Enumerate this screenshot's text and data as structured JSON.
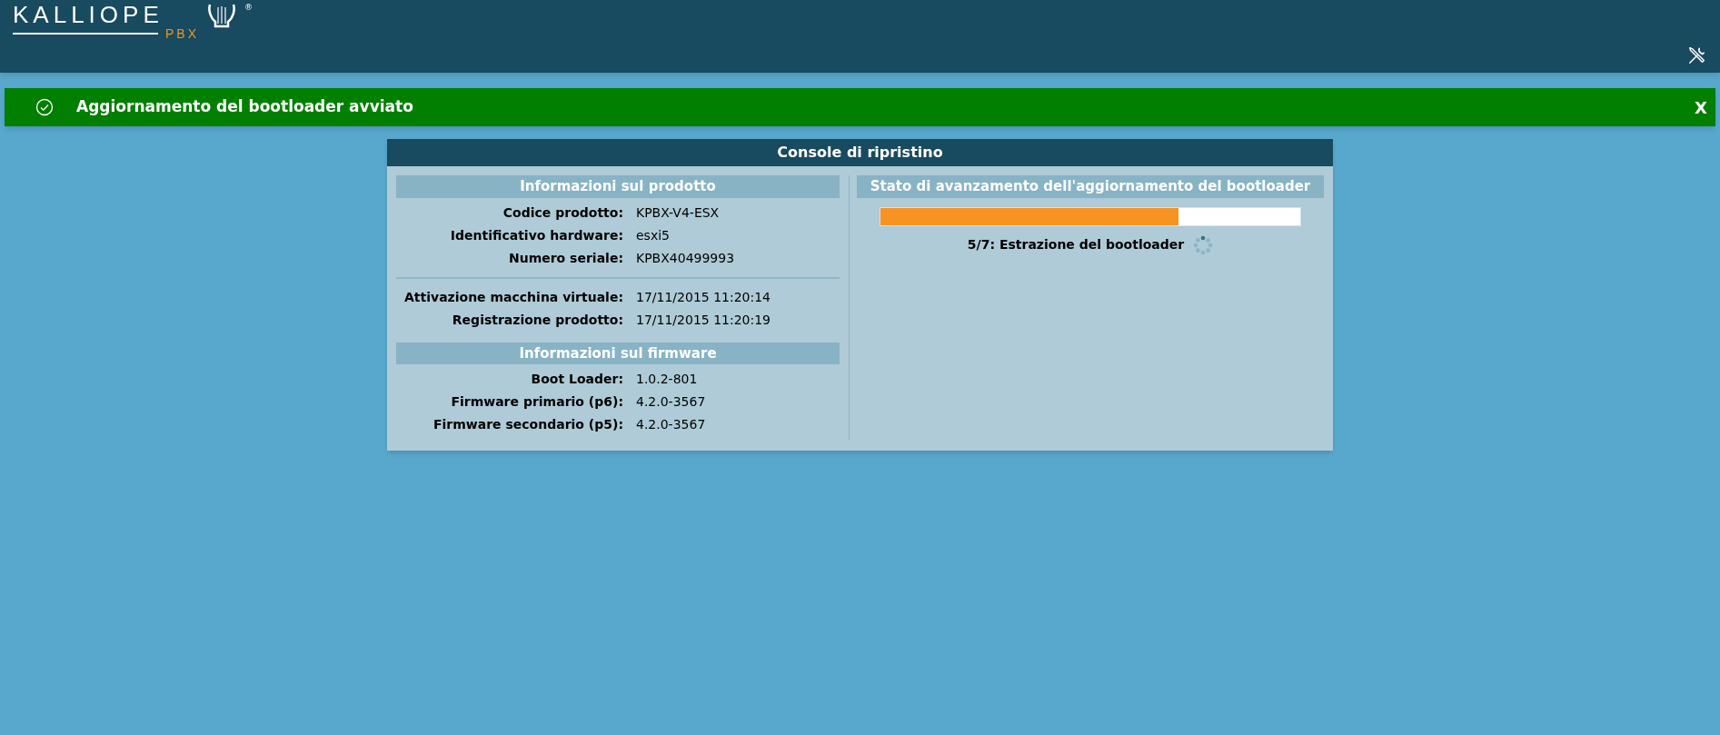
{
  "logo": {
    "name": "KALLIOPE",
    "suffix": "PBX",
    "mark": "®"
  },
  "notification": {
    "message": "Aggiornamento del bootloader avviato",
    "close": "X"
  },
  "console": {
    "title": "Console di ripristino",
    "left_sections": [
      {
        "title": "Informazioni sul prodotto",
        "groups": [
          [
            {
              "label": "Codice prodotto:",
              "value": "KPBX-V4-ESX"
            },
            {
              "label": "Identificativo hardware:",
              "value": "esxi5"
            },
            {
              "label": "Numero seriale:",
              "value": "KPBX40499993"
            }
          ],
          [
            {
              "label": "Attivazione macchina virtuale:",
              "value": "17/11/2015 11:20:14"
            },
            {
              "label": "Registrazione prodotto:",
              "value": "17/11/2015 11:20:19"
            }
          ]
        ]
      },
      {
        "title": "Informazioni sul firmware",
        "groups": [
          [
            {
              "label": "Boot Loader:",
              "value": "1.0.2-801"
            },
            {
              "label": "Firmware primario (p6):",
              "value": "4.2.0-3567"
            },
            {
              "label": "Firmware secondario (p5):",
              "value": "4.2.0-3567"
            }
          ]
        ]
      }
    ],
    "progress": {
      "title": "Stato di avanzamento dell'aggiornamento del bootloader",
      "level": 0.71,
      "step": "5/7: Estrazione del bootloader"
    }
  }
}
